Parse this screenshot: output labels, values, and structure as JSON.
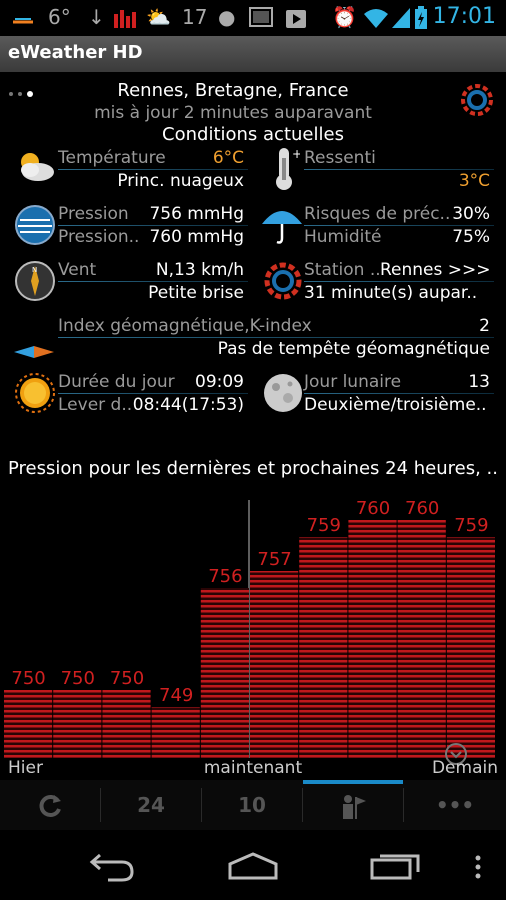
{
  "status_bar": {
    "temp": "6°",
    "temp2": "17",
    "time": "17:01"
  },
  "app": {
    "title": "eWeather HD"
  },
  "header": {
    "location": "Rennes, Bretagne, France",
    "updated": "mis à jour 2 minutes auparavant",
    "section": "Conditions actuelles"
  },
  "conditions": {
    "temperature_label": "Température",
    "temperature_value": "6°C",
    "sky": "Princ. nuageux",
    "feels_label": "Ressenti",
    "feels_value": "3°C",
    "pressure_label": "Pression",
    "pressure_value": "756 mmHg",
    "pressure2_label": "Pression..",
    "pressure2_value": "760 mmHg",
    "precip_label": "Risques de préc..",
    "precip_value": "30%",
    "humidity_label": "Humidité",
    "humidity_value": "75%",
    "wind_label": "Vent",
    "wind_value": "N,13 km/h",
    "wind_desc": "Petite brise",
    "station_label": "Station ..",
    "station_value": "Rennes >>>",
    "station_desc": "31 minute(s) aupar..",
    "geomag_label": "Index géomagnétique,K-index",
    "geomag_value": "2",
    "geomag_desc": "Pas de tempête géomagnétique",
    "daylen_label": "Durée du jour",
    "daylen_value": "09:09",
    "sunrise_label": "Lever d..",
    "sunrise_value": "08:44(17:53)",
    "moon_label": "Jour lunaire",
    "moon_value": "13",
    "moon_desc": "Deuxième/troisième.."
  },
  "chart_title": "Pression pour les dernières et prochaines 24 heures, ..",
  "chart_data": {
    "type": "bar",
    "values": [
      750,
      750,
      750,
      749,
      756,
      757,
      759,
      760,
      760,
      759
    ],
    "ylim": [
      746,
      760
    ],
    "x_labels": {
      "left": "Hier",
      "center": "maintenant",
      "right": "Demain"
    },
    "bar_color": "#c0181c",
    "label_color": "#d02020"
  },
  "toolbar": {
    "tab_24": "24",
    "tab_10": "10",
    "more": "•••"
  }
}
